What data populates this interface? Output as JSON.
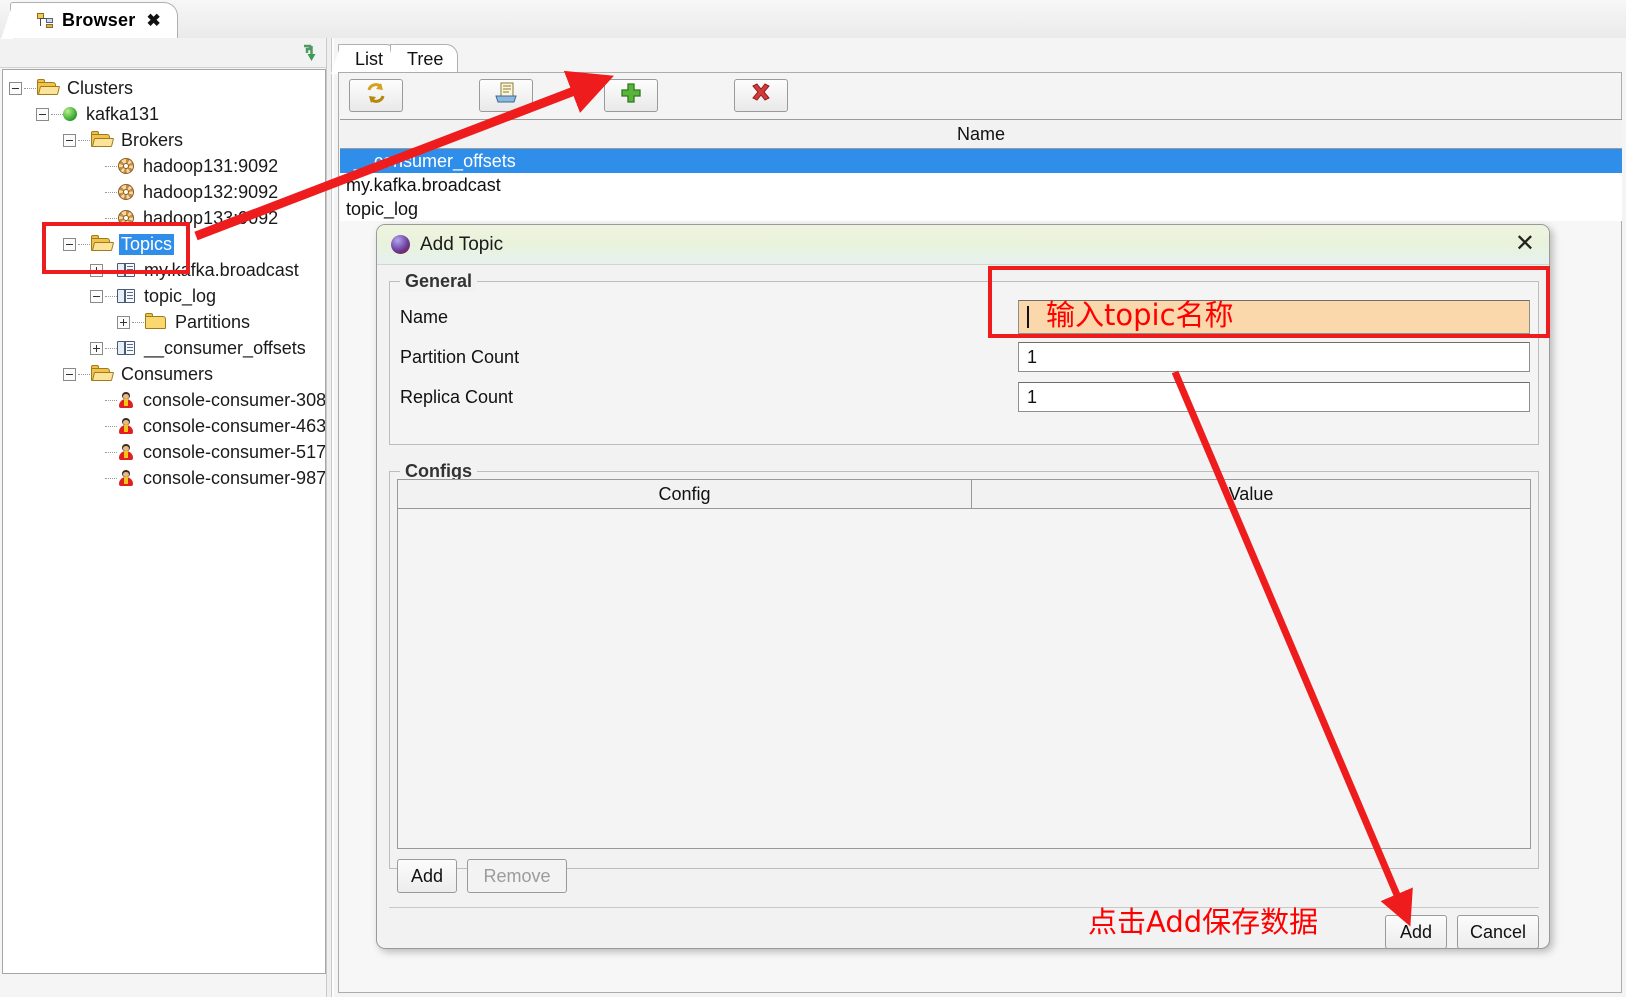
{
  "window": {
    "tab": {
      "label": "Browser",
      "close": "✖",
      "icon": "tree-hierarchy-icon"
    }
  },
  "sidebar": {
    "collapse_icon": "collapse-all-icon",
    "tree": [
      {
        "label": "Clusters",
        "depth": 0,
        "icon": "folder-open-icon",
        "toggle": "minus",
        "selected": false
      },
      {
        "label": "kafka131",
        "depth": 1,
        "icon": "green-sphere-icon",
        "toggle": "minus",
        "selected": false
      },
      {
        "label": "Brokers",
        "depth": 2,
        "icon": "folder-open-icon",
        "toggle": "minus",
        "selected": false
      },
      {
        "label": "hadoop131:9092",
        "depth": 3,
        "icon": "gear-icon",
        "toggle": "none",
        "selected": false
      },
      {
        "label": "hadoop132:9092",
        "depth": 3,
        "icon": "gear-icon",
        "toggle": "none",
        "selected": false
      },
      {
        "label": "hadoop133:9092",
        "depth": 3,
        "icon": "gear-icon",
        "toggle": "none",
        "selected": false
      },
      {
        "label": "Topics",
        "depth": 2,
        "icon": "folder-open-icon",
        "toggle": "minus",
        "selected": true
      },
      {
        "label": "my.kafka.broadcast",
        "depth": 3,
        "icon": "topic-book-icon",
        "toggle": "plus",
        "selected": false
      },
      {
        "label": "topic_log",
        "depth": 3,
        "icon": "topic-book-icon",
        "toggle": "minus",
        "selected": false
      },
      {
        "label": "Partitions",
        "depth": 4,
        "icon": "folder-closed-icon",
        "toggle": "plus",
        "selected": false
      },
      {
        "label": "__consumer_offsets",
        "depth": 3,
        "icon": "topic-book-icon",
        "toggle": "plus",
        "selected": false
      },
      {
        "label": "Consumers",
        "depth": 2,
        "icon": "folder-open-icon",
        "toggle": "minus",
        "selected": false
      },
      {
        "label": "console-consumer-308",
        "depth": 3,
        "icon": "consumer-icon",
        "toggle": "none",
        "selected": false
      },
      {
        "label": "console-consumer-463",
        "depth": 3,
        "icon": "consumer-icon",
        "toggle": "none",
        "selected": false
      },
      {
        "label": "console-consumer-517",
        "depth": 3,
        "icon": "consumer-icon",
        "toggle": "none",
        "selected": false
      },
      {
        "label": "console-consumer-987",
        "depth": 3,
        "icon": "consumer-icon",
        "toggle": "none",
        "selected": false
      }
    ]
  },
  "main": {
    "tabs": [
      {
        "label": "List",
        "active": true
      },
      {
        "label": "Tree",
        "active": false
      }
    ],
    "toolbar": [
      {
        "name": "refresh-button",
        "icon": "refresh-arrows-icon"
      },
      {
        "name": "export-button",
        "icon": "export-document-icon"
      },
      {
        "name": "add-button",
        "icon": "green-plus-icon"
      },
      {
        "name": "delete-button",
        "icon": "red-x-icon"
      }
    ],
    "list": {
      "column_header": "Name",
      "rows": [
        {
          "name": "__consumer_offsets",
          "selected": true
        },
        {
          "name": "my.kafka.broadcast",
          "selected": false
        },
        {
          "name": "topic_log",
          "selected": false
        }
      ]
    }
  },
  "dialog": {
    "title": "Add Topic",
    "icon": "app-sphere-icon",
    "close_label": "✕",
    "general": {
      "legend": "General",
      "fields": [
        {
          "label": "Name",
          "value": "",
          "highlight": true
        },
        {
          "label": "Partition Count",
          "value": "1",
          "highlight": false
        },
        {
          "label": "Replica Count",
          "value": "1",
          "highlight": false
        }
      ]
    },
    "configs": {
      "legend": "Configs",
      "columns": [
        "Config",
        "Value"
      ],
      "rows": [],
      "add_label": "Add",
      "remove_label": "Remove"
    },
    "footer": {
      "add_label": "Add",
      "cancel_label": "Cancel"
    }
  },
  "annotations": {
    "name_hint": "输入topic名称",
    "save_hint": "点击Add保存数据",
    "accent_red": "#ff0000",
    "box_red": "#ee1c1c"
  }
}
